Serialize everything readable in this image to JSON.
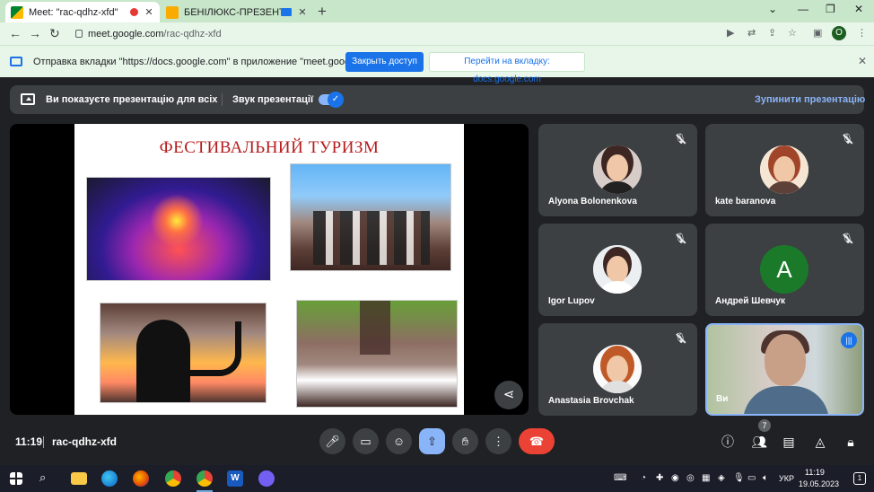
{
  "browser": {
    "tabs": [
      {
        "title": "Meet: \"rac-qdhz-xfd\"",
        "favicon": "google-meet-icon",
        "active": true
      },
      {
        "title": "БЕНІЛЮКС-ПРЕЗЕНТА.ppt",
        "favicon": "google-slides-icon",
        "active": false
      }
    ],
    "url_host": "meet.google.com",
    "url_path": "/rac-qdhz-xfd",
    "profile_initial": "O",
    "colors": {
      "frame": "#c8e6c9",
      "toolbar": "#e8f5e9",
      "accent": "#1a73e8"
    }
  },
  "infobar": {
    "message": "Отправка вкладки \"https://docs.google.com\" в приложение \"meet.google.com\"...",
    "close_tab_button": "Закрыть доступ",
    "switch_tab_button": "Перейти на вкладку: docs.google.com"
  },
  "present_banner": {
    "showing_label": "Ви показуєте презентацію для всіх",
    "sound_label": "Звук презентації",
    "sound_enabled": true,
    "stop_button": "Зупинити презентацію"
  },
  "slide": {
    "title": "ФЕСТИВАЛЬНИЙ ТУРИЗМ",
    "title_color": "#b71c1c",
    "photos": [
      "fireworks-festival",
      "street-band",
      "saxophonist-silhouette",
      "religious-procession"
    ]
  },
  "participants": [
    {
      "name": "Alyona Bolonenkova",
      "muted": true,
      "avatar": "photo"
    },
    {
      "name": "kate baranova",
      "muted": true,
      "avatar": "photo"
    },
    {
      "name": "Igor Lupov",
      "muted": true,
      "avatar": "photo"
    },
    {
      "name": "Андрей Шевчук",
      "muted": true,
      "avatar": "letter",
      "initial": "A",
      "avatar_color": "#1b7a2a"
    },
    {
      "name": "Anastasia Brovchak",
      "muted": true,
      "avatar": "photo"
    },
    {
      "name": "Ви",
      "muted": false,
      "avatar": "camera",
      "speaking": true
    }
  ],
  "meeting": {
    "time": "11:19",
    "code": "rac-qdhz-xfd",
    "people_count": "7",
    "controls": [
      "mic-icon",
      "camera-icon",
      "emoji-icon",
      "present-icon",
      "hand-icon",
      "more-icon",
      "leave-call-icon"
    ],
    "side_controls": [
      "info-icon",
      "people-icon",
      "chat-icon",
      "activities-icon",
      "host-controls-icon"
    ]
  },
  "taskbar": {
    "apps": [
      "file-explorer-icon",
      "edge-icon",
      "firefox-icon",
      "chrome-icon",
      "chrome-active-icon",
      "word-icon",
      "viber-icon"
    ],
    "language": "УКР",
    "clock_time": "11:19",
    "clock_date": "19.05.2023",
    "notification_count": "1"
  }
}
